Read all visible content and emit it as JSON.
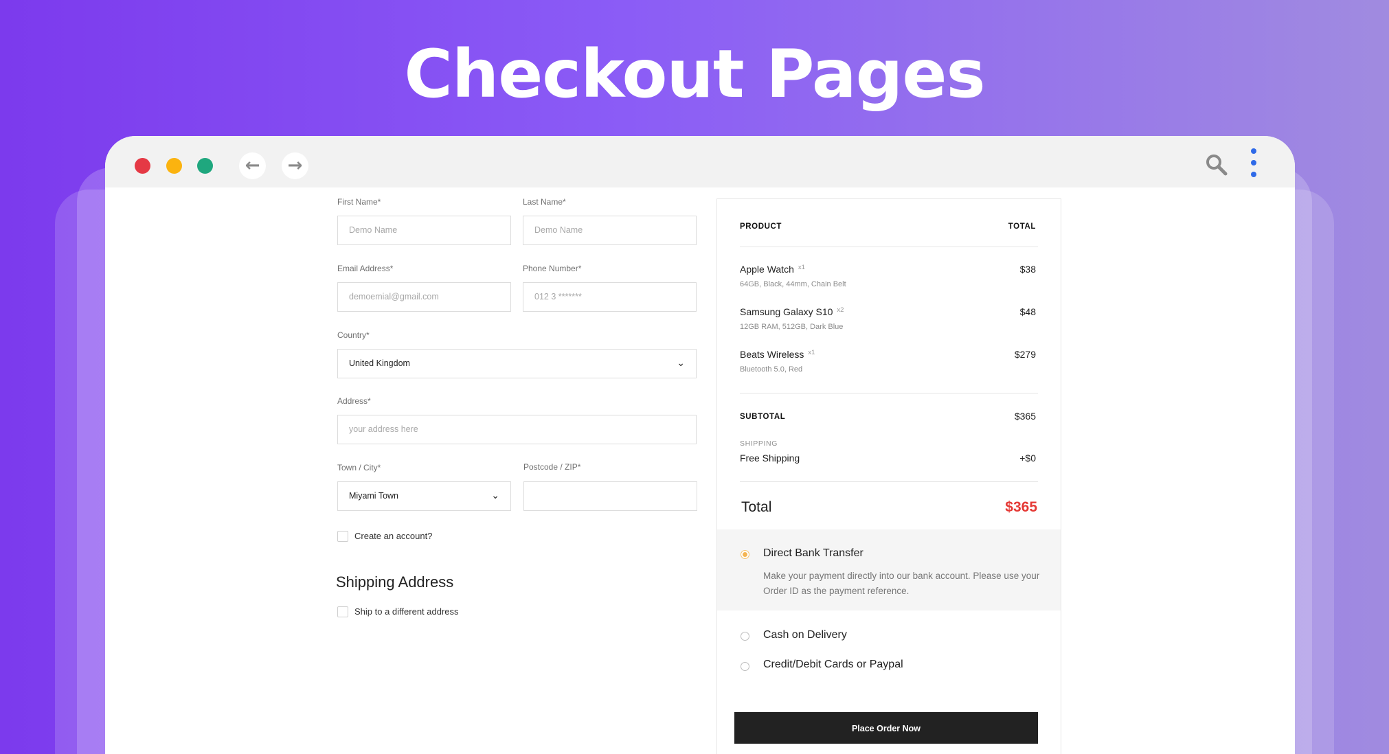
{
  "hero": {
    "title": "Checkout Pages"
  },
  "window": {
    "back_icon": "arrow-left-icon",
    "forward_icon": "arrow-right-icon",
    "search_icon": "search-icon",
    "menu_icon": "vertical-dots-icon",
    "dot_colors": [
      "#e53945",
      "#fbb30f",
      "#1fa77e"
    ]
  },
  "form": {
    "first_name": {
      "label": "First Name*",
      "placeholder": "Demo Name"
    },
    "last_name": {
      "label": "Last Name*",
      "placeholder": "Demo Name"
    },
    "email": {
      "label": "Email Address*",
      "placeholder": "demoemial@gmail.com"
    },
    "phone": {
      "label": "Phone Number*",
      "placeholder": "012 3  *******"
    },
    "country": {
      "label": "Country*",
      "value": "United Kingdom"
    },
    "address": {
      "label": "Address*",
      "placeholder": "your address here"
    },
    "town": {
      "label": "Town / City*",
      "value": "Miyami Town"
    },
    "postcode": {
      "label": "Postcode / ZIP*",
      "placeholder": ""
    },
    "create_account": "Create an account?",
    "shipping_title": "Shipping Address",
    "ship_different": "Ship to a different address"
  },
  "summary": {
    "product_header": "PRODUCT",
    "total_header": "TOTAL",
    "items": [
      {
        "name": "Apple Watch",
        "qty": "x1",
        "desc": "64GB, Black, 44mm, Chain Belt",
        "price": "$38"
      },
      {
        "name": "Samsung Galaxy S10",
        "qty": "x2",
        "desc": "12GB RAM, 512GB, Dark Blue",
        "price": "$48"
      },
      {
        "name": "Beats Wireless",
        "qty": "x1",
        "desc": "Bluetooth 5.0, Red",
        "price": "$279"
      }
    ],
    "subtotal_label": "SUBTOTAL",
    "subtotal_value": "$365",
    "shipping_label": "SHIPPING",
    "shipping_method": "Free Shipping",
    "shipping_value": "+$0",
    "total_label": "Total",
    "total_value": "$365",
    "payment": {
      "bank": {
        "label": "Direct Bank Transfer",
        "desc": "Make your payment directly into our bank account. Please use your Order ID as the payment reference."
      },
      "cod": {
        "label": "Cash on Delivery"
      },
      "card": {
        "label": "Credit/Debit Cards or Paypal"
      }
    },
    "place_order": "Place Order Now",
    "accent_color": "#e53935"
  }
}
